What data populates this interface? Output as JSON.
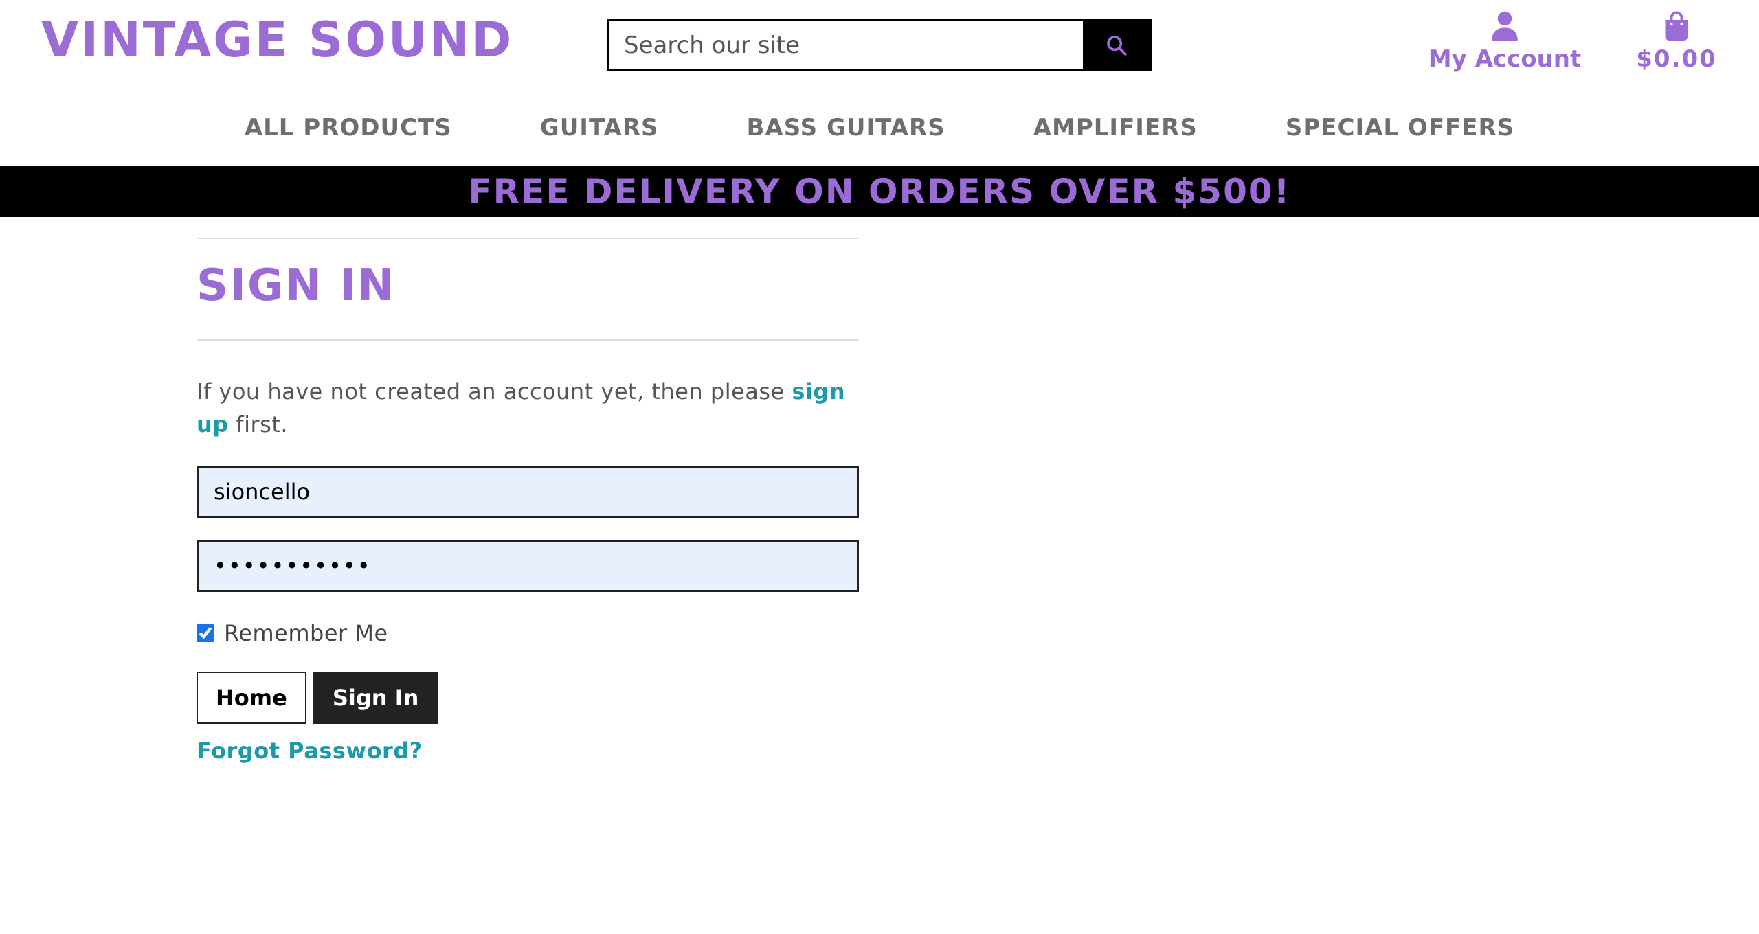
{
  "header": {
    "logo": "VINTAGE SOUND",
    "search": {
      "placeholder": "Search our site",
      "value": "",
      "button_icon": "search-icon"
    },
    "account": {
      "icon": "user-icon",
      "label": "My Account"
    },
    "cart": {
      "icon": "shopping-bag-icon",
      "total": "$0.00"
    }
  },
  "nav": {
    "items": [
      {
        "label": "ALL PRODUCTS"
      },
      {
        "label": "GUITARS"
      },
      {
        "label": "BASS GUITARS"
      },
      {
        "label": "AMPLIFIERS"
      },
      {
        "label": "SPECIAL OFFERS"
      }
    ]
  },
  "banner": {
    "text": "FREE DELIVERY ON ORDERS OVER $500!"
  },
  "signin": {
    "title": "SIGN IN",
    "intro_before": "If you have not created an account yet, then please ",
    "signup_link": "sign up",
    "intro_after": " first.",
    "username": {
      "value": "sioncello"
    },
    "password": {
      "value": "•••••••••••"
    },
    "remember_label": "Remember Me",
    "remember_checked": true,
    "home_button": "Home",
    "signin_button": "Sign In",
    "forgot_link": "Forgot Password?"
  },
  "colors": {
    "brand": "#9b6bd6",
    "link": "#1b9aaa",
    "nav_text": "#6e6e6e",
    "autofill_bg": "#e8f0fe"
  }
}
